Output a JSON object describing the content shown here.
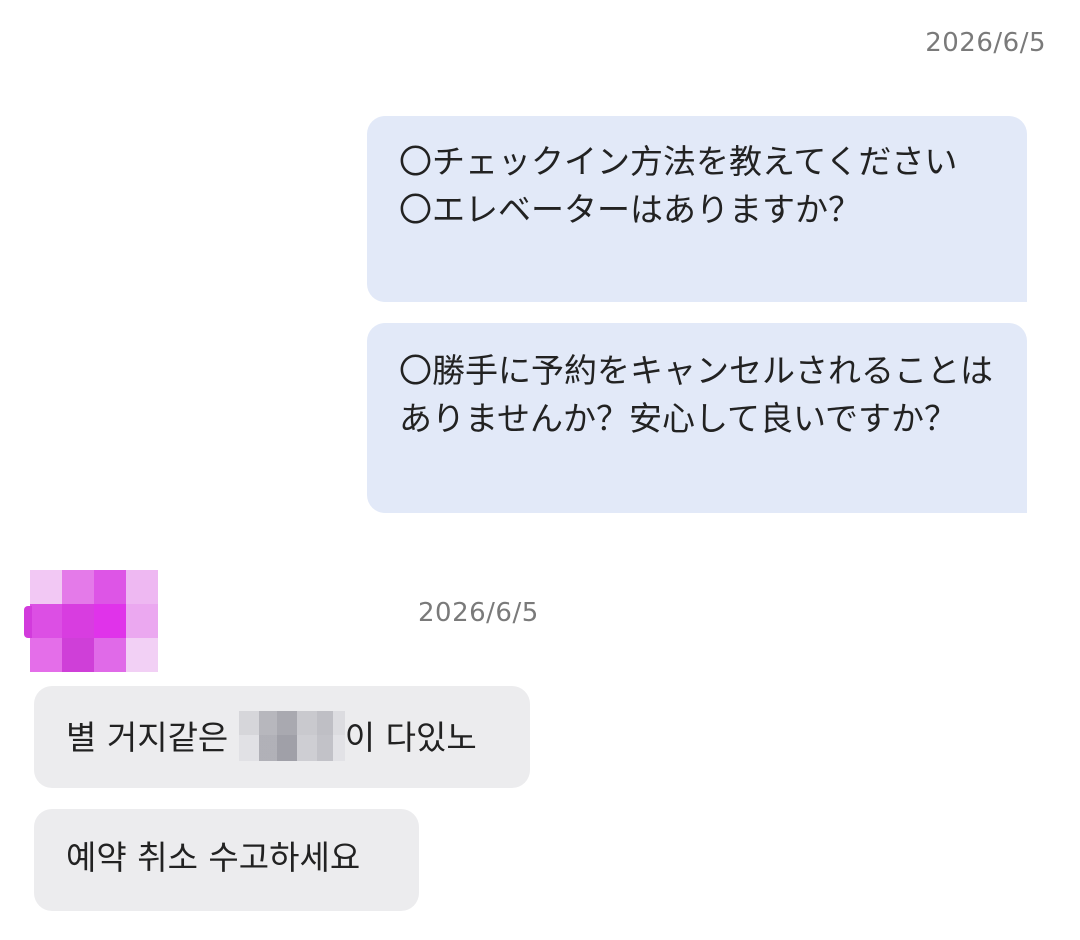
{
  "conversation": {
    "sent_timestamp": "2026/6/5",
    "sent_messages": [
      {
        "text": "〇チェックイン方法を教えてください\n〇エレベーターはありますか？"
      },
      {
        "text": "〇勝手に予約をキャンセルされることはありませんか？安心して良いですか？"
      }
    ],
    "received_timestamp": "2026/6/5",
    "received_messages": [
      {
        "text_before": "별 거지같은 ",
        "text_after": "이 다있노"
      },
      {
        "text": "예약 취소 수고하세요"
      }
    ]
  },
  "colors": {
    "sent_bubble": "#e2e9f8",
    "received_bubble": "#ececee",
    "timestamp": "#7a7a7a",
    "avatar_pixelation": "#e040e8"
  },
  "icons": {
    "avatar": "pixelated-avatar-icon"
  }
}
